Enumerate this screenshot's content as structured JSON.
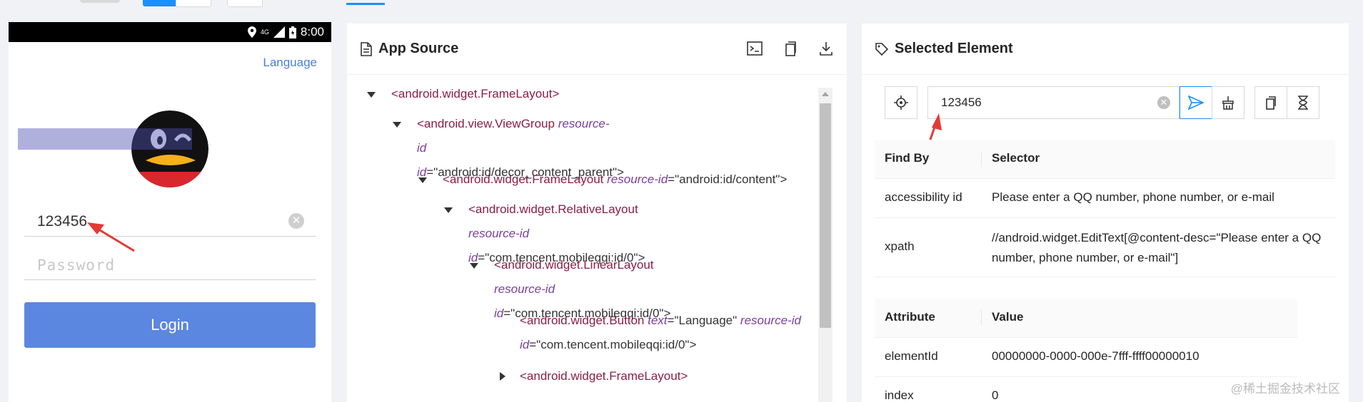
{
  "phone": {
    "status": {
      "time": "8:00",
      "network": "4G"
    },
    "language_link": "Language",
    "username_value": "123456",
    "password_placeholder": "Password",
    "login_label": "Login"
  },
  "source": {
    "title": "App Source",
    "icons": [
      "terminal-icon",
      "copy-icon",
      "download-icon"
    ],
    "tree": [
      {
        "level": 0,
        "expanded": true,
        "tag": "<android.widget.FrameLayout>"
      },
      {
        "level": 1,
        "expanded": true,
        "tag": "<android.view.ViewGroup",
        "attrs": [
          {
            "name": "resource-id",
            "value": "\"android:id/decor_content_parent\">"
          }
        ]
      },
      {
        "level": 2,
        "expanded": true,
        "tag": "<android.widget.FrameLayout",
        "attrs": [
          {
            "name": "resource-id",
            "value": "\"android:id/content\">"
          }
        ]
      },
      {
        "level": 3,
        "expanded": true,
        "tag": "<android.widget.RelativeLayout",
        "attrs": [
          {
            "name": "resource-id",
            "value": "\"com.tencent.mobileqqi:id/0\">"
          }
        ]
      },
      {
        "level": 4,
        "expanded": true,
        "tag": "<android.widget.LinearLayout",
        "attrs": [
          {
            "name": "resource-id",
            "value": "\"com.tencent.mobileqqi:id/0\">"
          }
        ]
      },
      {
        "level": 5,
        "leaf": true,
        "tag": "<android.widget.Button",
        "attrs": [
          {
            "name": "text",
            "value": "\"Language\""
          },
          {
            "name": "resource-id",
            "value": "\"com.tencent.mobileqqi:id/0\">"
          }
        ]
      },
      {
        "level": 5,
        "expanded": false,
        "tag": "<android.widget.FrameLayout>"
      }
    ]
  },
  "selected": {
    "title": "Selected Element",
    "search_value": "123456",
    "find_table": {
      "headers": [
        "Find By",
        "Selector"
      ],
      "rows": [
        [
          "accessibility id",
          "Please enter a QQ number, phone number, or e-mail"
        ],
        [
          "xpath",
          "//android.widget.EditText[@content-desc=\"Please enter a QQ number, phone number, or e-mail\"]"
        ]
      ]
    },
    "attr_table": {
      "headers": [
        "Attribute",
        "Value"
      ],
      "rows": [
        [
          "elementId",
          "00000000-0000-000e-7fff-ffff00000010"
        ],
        [
          "index",
          "0"
        ]
      ]
    }
  },
  "watermark": "@稀土掘金技术社区",
  "colors": {
    "accent": "#1890ff",
    "login": "#5b87e0",
    "tag": "#8a1f41",
    "attr": "#7a3e9d"
  }
}
